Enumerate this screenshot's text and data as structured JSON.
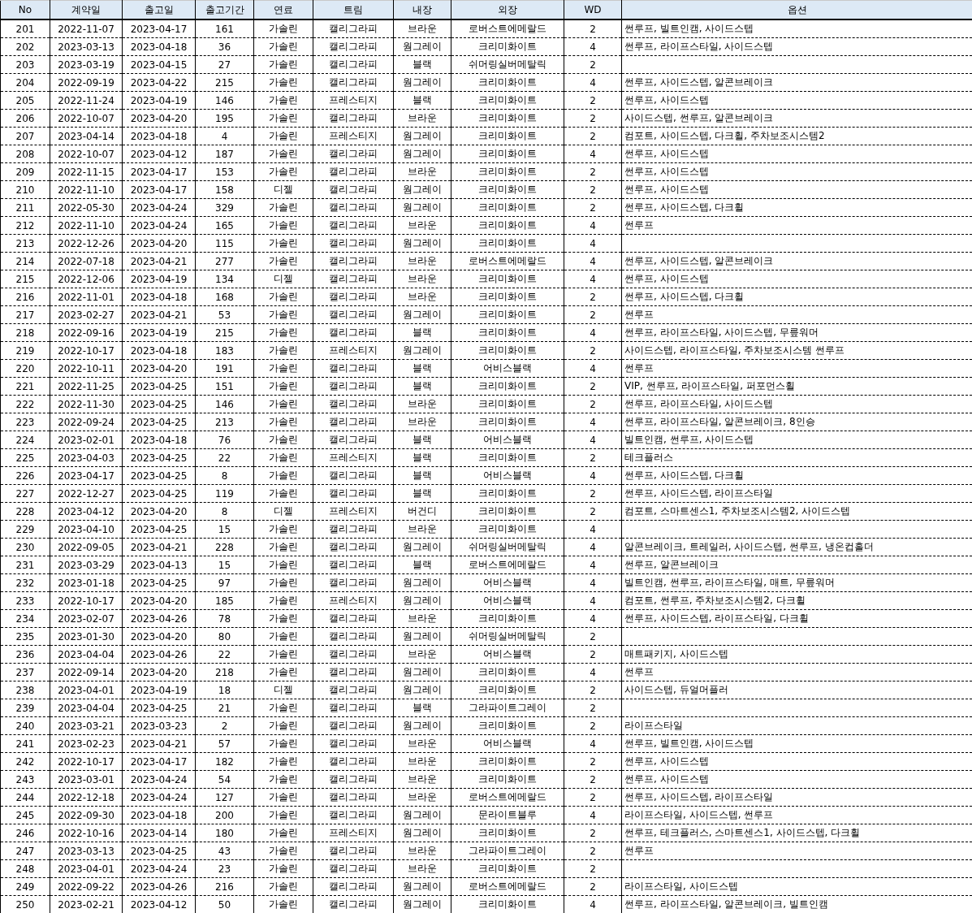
{
  "table": {
    "columns": [
      "No",
      "계약일",
      "출고일",
      "출고기간",
      "연료",
      "트림",
      "내장",
      "외장",
      "WD",
      "옵션"
    ],
    "rows": [
      [
        "201",
        "2022-11-07",
        "2023-04-17",
        "161",
        "가솔린",
        "캘리그라피",
        "브라운",
        "로버스트에메랄드",
        "2",
        "썬루프, 빌트인캠, 사이드스텝"
      ],
      [
        "202",
        "2023-03-13",
        "2023-04-18",
        "36",
        "가솔린",
        "캘리그라피",
        "웜그레이",
        "크리미화이트",
        "4",
        "썬루프, 라이프스타일, 사이드스텝"
      ],
      [
        "203",
        "2023-03-19",
        "2023-04-15",
        "27",
        "가솔린",
        "캘리그라피",
        "블랙",
        "쉬머링실버메탈릭",
        "2"
      ],
      [
        "204",
        "2022-09-19",
        "2023-04-22",
        "215",
        "가솔린",
        "캘리그라피",
        "웜그레이",
        "크리미화이트",
        "4",
        "썬루프, 사이드스텝, 알콘브레이크"
      ],
      [
        "205",
        "2022-11-24",
        "2023-04-19",
        "146",
        "가솔린",
        "프레스티지",
        "블랙",
        "크리미화이트",
        "2",
        "썬루프, 사이드스텝"
      ],
      [
        "206",
        "2022-10-07",
        "2023-04-20",
        "195",
        "가솔린",
        "캘리그라피",
        "브라운",
        "크리미화이트",
        "2",
        "사이드스텝, 썬루프, 알콘브레이크"
      ],
      [
        "207",
        "2023-04-14",
        "2023-04-18",
        "4",
        "가솔린",
        "프레스티지",
        "웜그레이",
        "크리미화이트",
        "2",
        "컴포트, 사이드스텝, 다크휠, 주차보조시스템2"
      ],
      [
        "208",
        "2022-10-07",
        "2023-04-12",
        "187",
        "가솔린",
        "캘리그라피",
        "웜그레이",
        "크리미화이트",
        "4",
        "썬루프, 사이드스텝"
      ],
      [
        "209",
        "2022-11-15",
        "2023-04-17",
        "153",
        "가솔린",
        "캘리그라피",
        "브라운",
        "크리미화이트",
        "2",
        "썬루프, 사이드스텝"
      ],
      [
        "210",
        "2022-11-10",
        "2023-04-17",
        "158",
        "디젤",
        "캘리그라피",
        "웜그레이",
        "크리미화이트",
        "2",
        "썬루프, 사이드스텝"
      ],
      [
        "211",
        "2022-05-30",
        "2023-04-24",
        "329",
        "가솔린",
        "캘리그라피",
        "웜그레이",
        "크리미화이트",
        "2",
        "썬루프, 사이드스텝, 다크휠"
      ],
      [
        "212",
        "2022-11-10",
        "2023-04-24",
        "165",
        "가솔린",
        "캘리그라피",
        "브라운",
        "크리미화이트",
        "4",
        "썬루프"
      ],
      [
        "213",
        "2022-12-26",
        "2023-04-20",
        "115",
        "가솔린",
        "캘리그라피",
        "웜그레이",
        "크리미화이트",
        "4"
      ],
      [
        "214",
        "2022-07-18",
        "2023-04-21",
        "277",
        "가솔린",
        "캘리그라피",
        "브라운",
        "로버스트에메랄드",
        "4",
        "썬루프, 사이드스텝, 알콘브레이크"
      ],
      [
        "215",
        "2022-12-06",
        "2023-04-19",
        "134",
        "디젤",
        "캘리그라피",
        "브라운",
        "크리미화이트",
        "4",
        "썬루프, 사이드스텝"
      ],
      [
        "216",
        "2022-11-01",
        "2023-04-18",
        "168",
        "가솔린",
        "캘리그라피",
        "브라운",
        "크리미화이트",
        "2",
        "썬루프, 사이드스텝, 다크휠"
      ],
      [
        "217",
        "2023-02-27",
        "2023-04-21",
        "53",
        "가솔린",
        "캘리그라피",
        "웜그레이",
        "크리미화이트",
        "2",
        "썬루프"
      ],
      [
        "218",
        "2022-09-16",
        "2023-04-19",
        "215",
        "가솔린",
        "캘리그라피",
        "블랙",
        "크리미화이트",
        "4",
        "썬루프, 라이프스타일, 사이드스텝, 무릎워머"
      ],
      [
        "219",
        "2022-10-17",
        "2023-04-18",
        "183",
        "가솔린",
        "프레스티지",
        "웜그레이",
        "크리미화이트",
        "2",
        "사이드스텝, 라이프스타일, 주차보조시스템 썬루프"
      ],
      [
        "220",
        "2022-10-11",
        "2023-04-20",
        "191",
        "가솔린",
        "캘리그라피",
        "블랙",
        "어비스블랙",
        "4",
        "썬루프"
      ],
      [
        "221",
        "2022-11-25",
        "2023-04-25",
        "151",
        "가솔린",
        "캘리그라피",
        "블랙",
        "크리미화이트",
        "2",
        "VIP, 썬루프, 라이프스타일, 퍼포먼스휠"
      ],
      [
        "222",
        "2022-11-30",
        "2023-04-25",
        "146",
        "가솔린",
        "캘리그라피",
        "브라운",
        "크리미화이트",
        "2",
        "썬루프, 라이프스타일, 사이드스텝"
      ],
      [
        "223",
        "2022-09-24",
        "2023-04-25",
        "213",
        "가솔린",
        "캘리그라피",
        "브라운",
        "크리미화이트",
        "4",
        "썬루프, 라이프스타일, 알콘브레이크, 8인승"
      ],
      [
        "224",
        "2023-02-01",
        "2023-04-18",
        "76",
        "가솔린",
        "캘리그라피",
        "블랙",
        "어비스블랙",
        "4",
        "빌트인캠, 썬루프, 사이드스텝"
      ],
      [
        "225",
        "2023-04-03",
        "2023-04-25",
        "22",
        "가솔린",
        "프레스티지",
        "블랙",
        "크리미화이트",
        "2",
        "테크플러스"
      ],
      [
        "226",
        "2023-04-17",
        "2023-04-25",
        "8",
        "가솔린",
        "캘리그라피",
        "블랙",
        "어비스블랙",
        "4",
        "썬루프, 사이드스텝, 다크휠"
      ],
      [
        "227",
        "2022-12-27",
        "2023-04-25",
        "119",
        "가솔린",
        "캘리그라피",
        "블랙",
        "크리미화이트",
        "2",
        "썬루프, 사이드스텝, 라이프스타일"
      ],
      [
        "228",
        "2023-04-12",
        "2023-04-20",
        "8",
        "디젤",
        "프레스티지",
        "버건디",
        "크리미화이트",
        "2",
        "컴포트, 스마트센스1, 주차보조시스템2, 사이드스텝"
      ],
      [
        "229",
        "2023-04-10",
        "2023-04-25",
        "15",
        "가솔린",
        "캘리그라피",
        "브라운",
        "크리미화이트",
        "4"
      ],
      [
        "230",
        "2022-09-05",
        "2023-04-21",
        "228",
        "가솔린",
        "캘리그라피",
        "웜그레이",
        "쉬머링실버메탈릭",
        "4",
        "알콘브레이크, 트레일러, 사이드스텝, 썬루프, 냉온컵홀더"
      ],
      [
        "231",
        "2023-03-29",
        "2023-04-13",
        "15",
        "가솔린",
        "캘리그라피",
        "블랙",
        "로버스트에메랄드",
        "4",
        "썬루프, 알콘브레이크"
      ],
      [
        "232",
        "2023-01-18",
        "2023-04-25",
        "97",
        "가솔린",
        "캘리그라피",
        "웜그레이",
        "어비스블랙",
        "4",
        "빌트인캠, 썬루프, 라이프스타일, 매트, 무릎워머"
      ],
      [
        "233",
        "2022-10-17",
        "2023-04-20",
        "185",
        "가솔린",
        "프레스티지",
        "웜그레이",
        "어비스블랙",
        "4",
        "컴포트, 썬루프, 주차보조시스템2, 다크휠"
      ],
      [
        "234",
        "2023-02-07",
        "2023-04-26",
        "78",
        "가솔린",
        "캘리그라피",
        "브라운",
        "크리미화이트",
        "4",
        "썬루프, 사이드스텝, 라이프스타일, 다크휠"
      ],
      [
        "235",
        "2023-01-30",
        "2023-04-20",
        "80",
        "가솔린",
        "캘리그라피",
        "웜그레이",
        "쉬머링실버메탈릭",
        "2"
      ],
      [
        "236",
        "2023-04-04",
        "2023-04-26",
        "22",
        "가솔린",
        "캘리그라피",
        "브라운",
        "어비스블랙",
        "2",
        "매트패키지, 사이드스텝"
      ],
      [
        "237",
        "2022-09-14",
        "2023-04-20",
        "218",
        "가솔린",
        "캘리그라피",
        "웜그레이",
        "크리미화이트",
        "4",
        "썬루프"
      ],
      [
        "238",
        "2023-04-01",
        "2023-04-19",
        "18",
        "디젤",
        "캘리그라피",
        "웜그레이",
        "크리미화이트",
        "2",
        "사이드스텝, 듀얼머플러"
      ],
      [
        "239",
        "2023-04-04",
        "2023-04-25",
        "21",
        "가솔린",
        "캘리그라피",
        "블랙",
        "그라파이트그레이",
        "2"
      ],
      [
        "240",
        "2023-03-21",
        "2023-03-23",
        "2",
        "가솔린",
        "캘리그라피",
        "웜그레이",
        "크리미화이트",
        "2",
        "라이프스타일"
      ],
      [
        "241",
        "2023-02-23",
        "2023-04-21",
        "57",
        "가솔린",
        "캘리그라피",
        "브라운",
        "어비스블랙",
        "4",
        "썬루프, 빌트인캠, 사이드스텝"
      ],
      [
        "242",
        "2022-10-17",
        "2023-04-17",
        "182",
        "가솔린",
        "캘리그라피",
        "브라운",
        "크리미화이트",
        "2",
        "썬루프, 사이드스텝"
      ],
      [
        "243",
        "2023-03-01",
        "2023-04-24",
        "54",
        "가솔린",
        "캘리그라피",
        "브라운",
        "크리미화이트",
        "2",
        "썬루프, 사이드스텝"
      ],
      [
        "244",
        "2022-12-18",
        "2023-04-24",
        "127",
        "가솔린",
        "캘리그라피",
        "브라운",
        "로버스트에메랄드",
        "2",
        "썬루프, 사이드스텝, 라이프스타일"
      ],
      [
        "245",
        "2022-09-30",
        "2023-04-18",
        "200",
        "가솔린",
        "캘리그라피",
        "웜그레이",
        "문라이트블루",
        "4",
        "라이프스타일, 사이드스텝, 썬루프"
      ],
      [
        "246",
        "2022-10-16",
        "2023-04-14",
        "180",
        "가솔린",
        "프레스티지",
        "웜그레이",
        "크리미화이트",
        "2",
        "썬루프, 테크플러스, 스마트센스1, 사이드스텝, 다크휠"
      ],
      [
        "247",
        "2023-03-13",
        "2023-04-25",
        "43",
        "가솔린",
        "캘리그라피",
        "브라운",
        "그라파이트그레이",
        "2",
        "썬루프"
      ],
      [
        "248",
        "2023-04-01",
        "2023-04-24",
        "23",
        "가솔린",
        "캘리그라피",
        "브라운",
        "크리미화이트",
        "2"
      ],
      [
        "249",
        "2022-09-22",
        "2023-04-26",
        "216",
        "가솔린",
        "캘리그라피",
        "웜그레이",
        "로버스트에메랄드",
        "2",
        "라이프스타일, 사이드스텝"
      ],
      [
        "250",
        "2023-02-21",
        "2023-04-12",
        "50",
        "가솔린",
        "캘리그라피",
        "웜그레이",
        "크리미화이트",
        "4",
        "썬루프, 라이프스타일, 알콘브레이크, 빌트인캠"
      ]
    ]
  }
}
